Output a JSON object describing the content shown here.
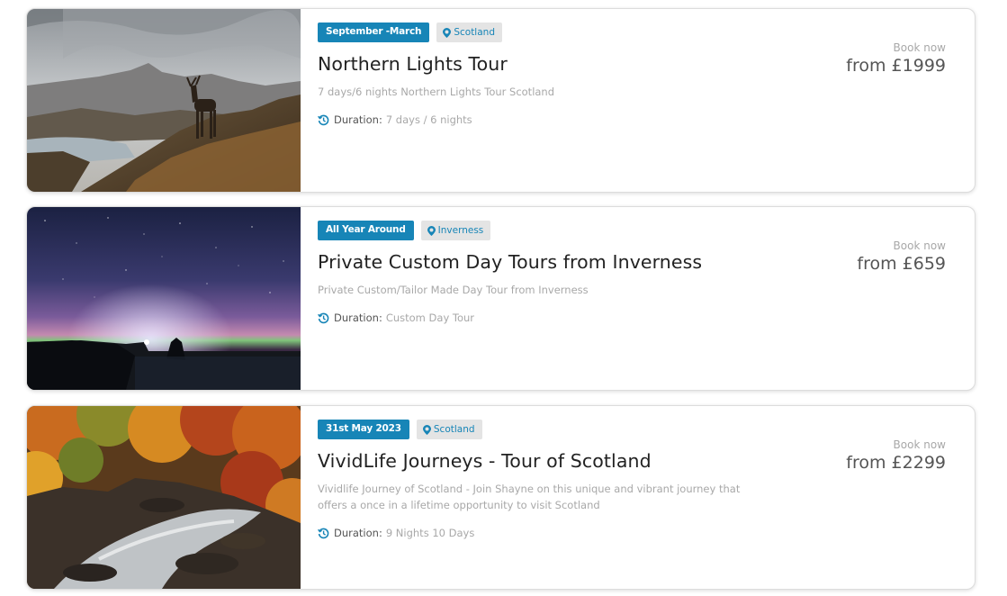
{
  "tours": [
    {
      "date_tag": "September -March",
      "location": "Scotland",
      "title": "Northern Lights Tour",
      "description": "7 days/6 nights Northern Lights Tour Scotland",
      "duration_label": "Duration:",
      "duration": "7 days / 6 nights",
      "book_now": "Book now",
      "price": "from £1999"
    },
    {
      "date_tag": "All Year Around",
      "location": "Inverness",
      "title": "Private Custom Day Tours from Inverness",
      "description": "Private Custom/Tailor Made Day Tour from Inverness",
      "duration_label": "Duration:",
      "duration": "Custom Day Tour",
      "book_now": "Book now",
      "price": "from £659"
    },
    {
      "date_tag": "31st May 2023",
      "location": "Scotland",
      "title": "VividLife Journeys - Tour of Scotland",
      "description": "Vividlife Journey of Scotland - Join Shayne on this unique and vibrant journey that offers a once in a lifetime opportunity to visit Scotland",
      "duration_label": "Duration:",
      "duration": "9 Nights 10 Days",
      "book_now": "Book now",
      "price": "from £2299"
    }
  ],
  "colors": {
    "accent": "#1785b7",
    "tag_bg": "#e4e4e4",
    "muted": "#a8a8a8"
  },
  "icons": {
    "location": "map-pin-icon",
    "duration": "history-clock-icon"
  }
}
